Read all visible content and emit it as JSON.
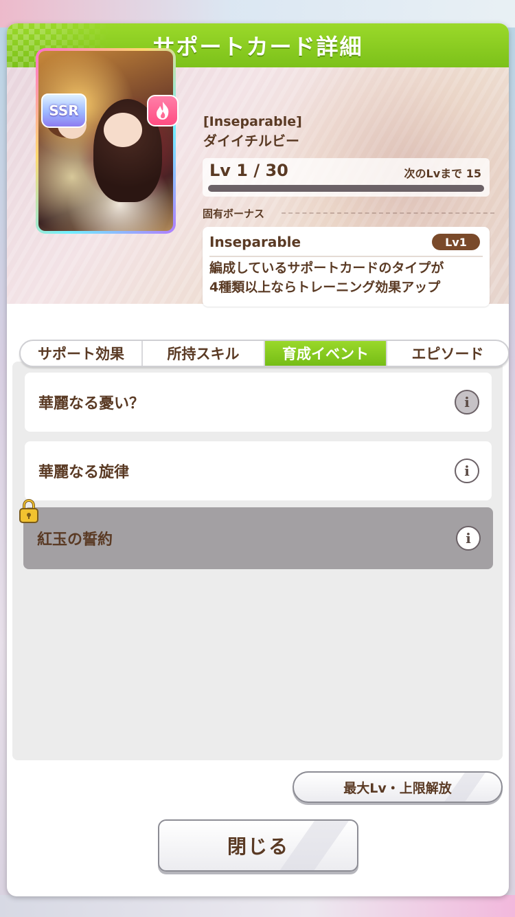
{
  "header": {
    "title": "サポートカード詳細"
  },
  "card": {
    "rarity": "SSR",
    "type_icon": "flame-icon",
    "title": "[Inseparable]",
    "name": "ダイイチルビー",
    "level_text": "Lv 1 / 30",
    "next_level_text": "次のLvまで 15",
    "level_progress": 0
  },
  "bonus": {
    "section_label": "固有ボーナス",
    "name": "Inseparable",
    "level_badge": "Lv1",
    "description_line1": "編成しているサポートカードのタイプが",
    "description_line2": "4種類以上ならトレーニング効果アップ"
  },
  "tabs": [
    {
      "label": "サポート効果",
      "active": false
    },
    {
      "label": "所持スキル",
      "active": false
    },
    {
      "label": "育成イベント",
      "active": true
    },
    {
      "label": "エピソード",
      "active": false
    }
  ],
  "events": [
    {
      "label": "華麗なる憂い？",
      "locked": false
    },
    {
      "label": "華麗なる旋律",
      "locked": false
    },
    {
      "label": "紅玉の誓約",
      "locked": true
    }
  ],
  "buttons": {
    "max_level": "最大Lv・上限解放",
    "close": "閉じる"
  },
  "colors": {
    "header_green": "#7cc11a",
    "text_brown": "#5a3a24",
    "level_badge_brown": "#7a4a2a",
    "locked_row_grey": "#a3a0a3"
  }
}
